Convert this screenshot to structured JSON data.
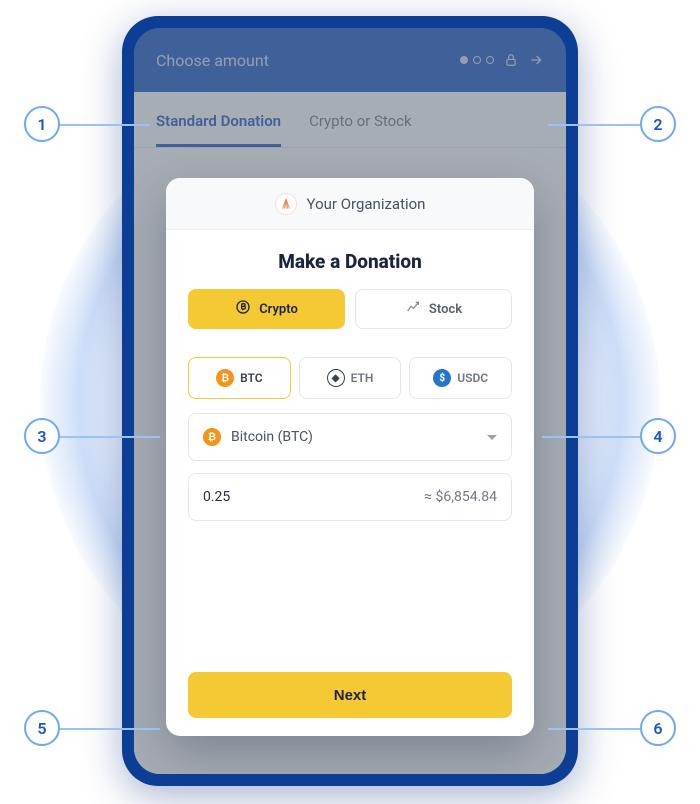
{
  "topbar": {
    "title": "Choose amount"
  },
  "tabs": {
    "standard": "Standard Donation",
    "crypto_stock": "Crypto or Stock"
  },
  "modal": {
    "org_name": "Your Organization",
    "title": "Make a Donation",
    "type_crypto": "Crypto",
    "type_stock": "Stock",
    "coin_btc": "BTC",
    "coin_eth": "ETH",
    "coin_usdc": "USDC",
    "selected_currency": "Bitcoin (BTC)",
    "amount_value": "0.25",
    "amount_approx": "≈ $6,854.84",
    "next_label": "Next"
  },
  "callouts": {
    "c1": "1",
    "c2": "2",
    "c3": "3",
    "c4": "4",
    "c5": "5",
    "c6": "6"
  },
  "colors": {
    "accent": "#f5c934",
    "primary": "#1a56c4"
  }
}
